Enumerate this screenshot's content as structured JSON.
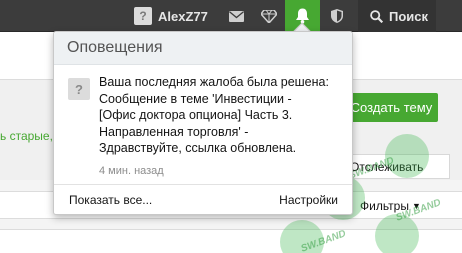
{
  "nav": {
    "user": {
      "avatar_letter": "?",
      "username": "AlexZ77"
    },
    "icons": [
      "envelope-icon",
      "diamond-icon",
      "bell-icon",
      "shield-icon",
      "search-icon"
    ],
    "search_label": "Поиск",
    "active_color": "#47a832"
  },
  "page": {
    "create_thread_label": "Создать тему",
    "side_text": "ь старые,",
    "watch_label": "Отслеживать",
    "filters_label": "Фильтры",
    "watermark_text": "SW.BAND"
  },
  "alerts_popup": {
    "title": "Оповещения",
    "item": {
      "avatar_letter": "?",
      "lines": [
        "Ваша последняя жалоба была решена:",
        "Сообщение в теме 'Инвестиции -",
        "[Офис доктора опциона] Часть 3.",
        "Направленная торговля' -",
        "Здравствуйте, ссылка обновлена."
      ],
      "time": "4 мин. назад"
    },
    "show_all_label": "Показать все...",
    "settings_label": "Настройки"
  }
}
